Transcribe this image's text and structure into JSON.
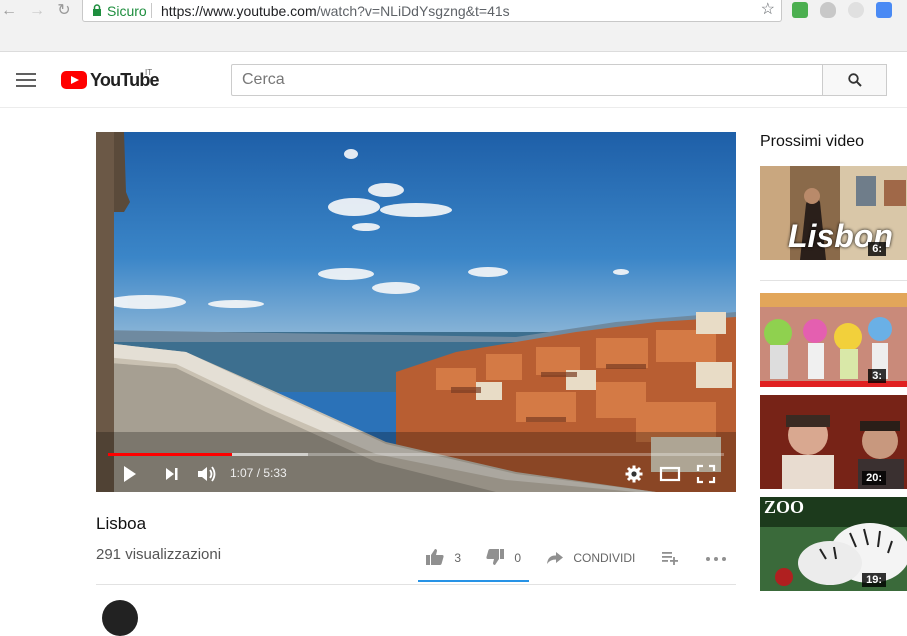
{
  "browser": {
    "secure_label": "Sicuro",
    "url_main": "https://www.youtube.com",
    "url_rest": "/watch?v=NLiDdYsgzng&t=41s"
  },
  "masthead": {
    "logo_text": "YouTube",
    "region": "IT",
    "search_placeholder": "Cerca"
  },
  "player": {
    "current_time": "1:07",
    "duration": "5:33",
    "time_display": "1:07 / 5:33",
    "played_fraction": 0.201,
    "buffered_fraction": 0.325
  },
  "video": {
    "title": "Lisboa",
    "views": "291 visualizzazioni",
    "likes": "3",
    "dislikes": "0",
    "share_label": "CONDIVIDI"
  },
  "sidebar": {
    "title": "Prossimi video",
    "items": [
      {
        "overlay_text": "Lisbon",
        "duration": "6:"
      },
      {
        "overlay_text": "",
        "duration": "3:"
      },
      {
        "overlay_text": "",
        "duration": "20:"
      },
      {
        "overlay_text": "ZOO",
        "duration": "19:"
      }
    ]
  },
  "colors": {
    "brand_red": "#ff0000",
    "secure_green": "#1e8e3e",
    "sentiment_blue": "#2793e6"
  },
  "icons": [
    "back-icon",
    "forward-icon",
    "reload-icon",
    "lock-icon",
    "star-icon",
    "menu-icon",
    "search-icon",
    "play-icon",
    "next-icon",
    "volume-icon",
    "settings-icon",
    "theater-icon",
    "fullscreen-icon",
    "thumb-up-icon",
    "thumb-down-icon",
    "share-icon",
    "add-to-playlist-icon",
    "more-icon"
  ]
}
